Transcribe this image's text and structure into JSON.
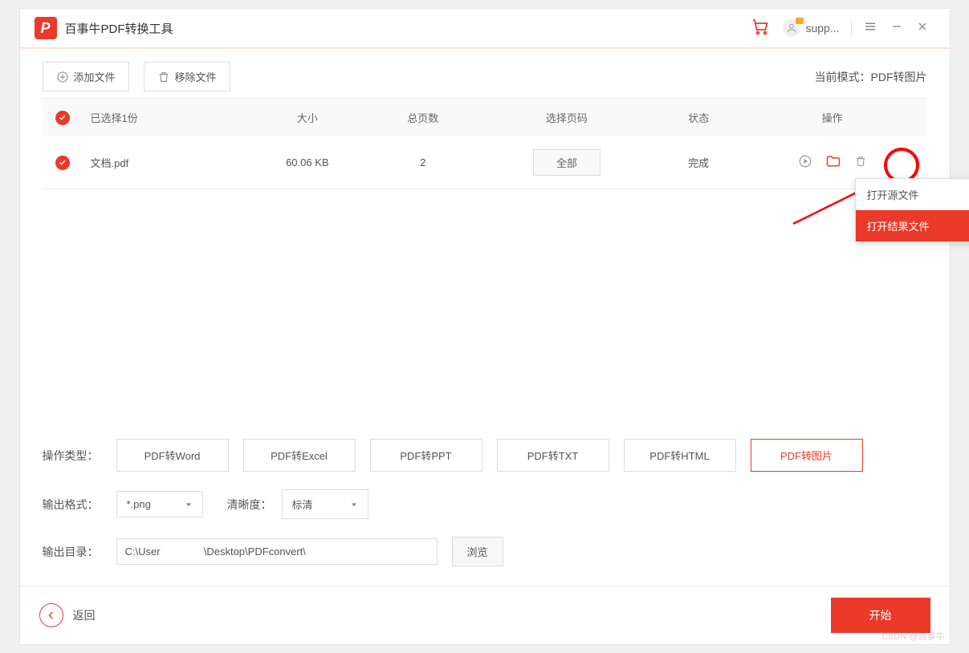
{
  "app": {
    "logo_letter": "P",
    "title": "百事牛PDF转换工具",
    "user_label": "supp..."
  },
  "toolbar": {
    "add_file": "添加文件",
    "remove_file": "移除文件",
    "mode_label": "当前模式：PDF转图片"
  },
  "table": {
    "headers": {
      "selected": "已选择1份",
      "size": "大小",
      "pages": "总页数",
      "page_select": "选择页码",
      "status": "状态",
      "action": "操作"
    },
    "rows": [
      {
        "name": "文档.pdf",
        "size": "60.06 KB",
        "pages": "2",
        "page_select": "全部",
        "status": "完成"
      }
    ]
  },
  "ctx_menu": {
    "open_source": "打开源文件",
    "open_result": "打开结果文件"
  },
  "options": {
    "type_label": "操作类型：",
    "types": [
      "PDF转Word",
      "PDF转Excel",
      "PDF转PPT",
      "PDF转TXT",
      "PDF转HTML",
      "PDF转图片"
    ],
    "active_type_index": 5,
    "format_label": "输出格式：",
    "format_value": "*.png",
    "quality_label": "清晰度：",
    "quality_value": "标清",
    "outdir_label": "输出目录：",
    "outdir_value": "C:\\User               \\Desktop\\PDFconvert\\",
    "browse": "浏览"
  },
  "footer": {
    "back": "返回",
    "start": "开始"
  },
  "watermark": "CSDN @百事牛"
}
